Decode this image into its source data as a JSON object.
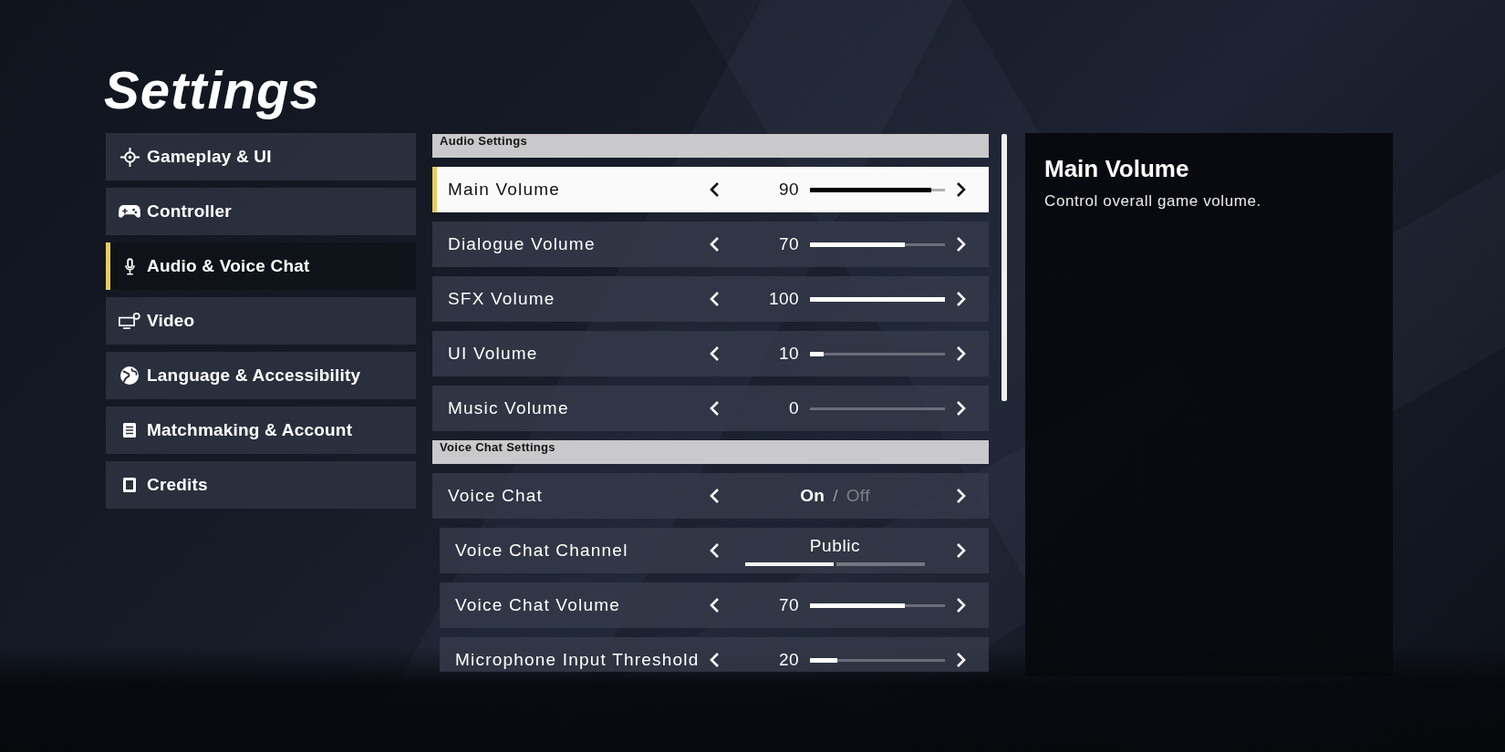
{
  "title": "Settings",
  "sidebar": {
    "items": [
      {
        "label": "Gameplay & UI",
        "selected": false
      },
      {
        "label": "Controller",
        "selected": false
      },
      {
        "label": "Audio & Voice Chat",
        "selected": true
      },
      {
        "label": "Video",
        "selected": false
      },
      {
        "label": "Language & Accessibility",
        "selected": false
      },
      {
        "label": "Matchmaking & Account",
        "selected": false
      },
      {
        "label": "Credits",
        "selected": false
      }
    ]
  },
  "settings": {
    "sections": [
      {
        "header": "Audio Settings",
        "rows": [
          {
            "kind": "slider",
            "label": "Main Volume",
            "selected": true,
            "value": "90",
            "level": 0.9
          },
          {
            "kind": "slider",
            "label": "Dialogue Volume",
            "selected": false,
            "value": "70",
            "level": 0.7
          },
          {
            "kind": "slider",
            "label": "SFX Volume",
            "selected": false,
            "value": "100",
            "level": 1
          },
          {
            "kind": "slider",
            "label": "UI Volume",
            "selected": false,
            "value": "10",
            "level": 0.1
          },
          {
            "kind": "slider",
            "label": "Music Volume",
            "selected": false,
            "value": "0",
            "level": 0
          }
        ]
      },
      {
        "header": "Voice Chat Settings",
        "rows": [
          {
            "kind": "toggle",
            "label": "Voice Chat",
            "selected": false,
            "options": [
              {
                "label": "On",
                "selected": true
              },
              {
                "label": "Off",
                "selected": false
              }
            ],
            "separator": "/",
            "children": [
              {
                "kind": "choice",
                "label": "Voice Chat Channel",
                "selected": false,
                "value": "Public",
                "pages": [
                  {
                    "selected": true
                  },
                  {
                    "selected": false
                  }
                ]
              },
              {
                "kind": "slider",
                "label": "Voice Chat Volume",
                "selected": false,
                "value": "70",
                "level": 0.7
              },
              {
                "kind": "slider",
                "label": "Microphone Input Threshold",
                "selected": false,
                "value": "20",
                "level": 0.2
              }
            ]
          }
        ]
      }
    ]
  },
  "detail": {
    "title": "Main Volume",
    "description": "Control overall game volume."
  }
}
